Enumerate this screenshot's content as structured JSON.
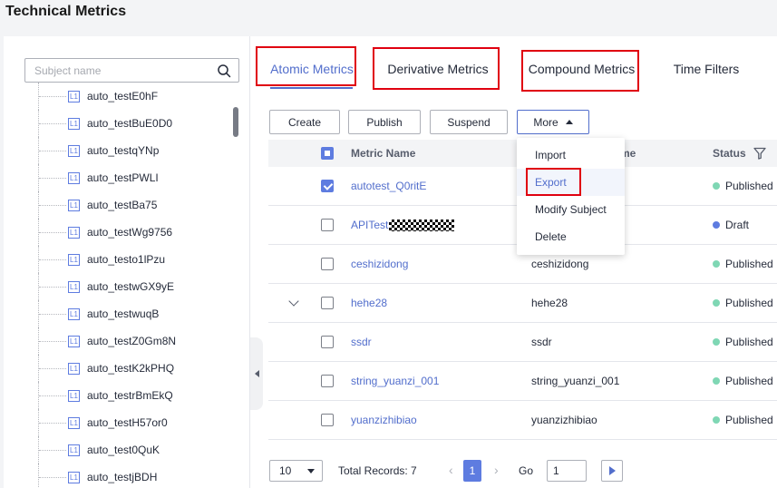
{
  "page": {
    "title": "Technical Metrics"
  },
  "sidebar": {
    "search_placeholder": "Subject name",
    "items": [
      "auto_testE0hF",
      "auto_testBuE0D0",
      "auto_testqYNp",
      "auto_testPWLI",
      "auto_testBa75",
      "auto_testWg9756",
      "auto_testo1lPzu",
      "auto_testwGX9yE",
      "auto_testwuqB",
      "auto_testZ0Gm8N",
      "auto_testK2kPHQ",
      "auto_testrBmEkQ",
      "auto_testH57or0",
      "auto_test0QuK",
      "auto_testjBDH"
    ],
    "leaf_icon_text": "L1"
  },
  "tabs": [
    "Atomic Metrics",
    "Derivative Metrics",
    "Compound Metrics",
    "Time Filters"
  ],
  "toolbar": {
    "create": "Create",
    "publish": "Publish",
    "suspend": "Suspend",
    "more": "More"
  },
  "dropdown": {
    "items": [
      "Import",
      "Export",
      "Modify Subject",
      "Delete"
    ]
  },
  "table": {
    "columns": {
      "metric_name": "Metric Name",
      "hidden_name_fragment": "me",
      "status": "Status"
    },
    "rows": [
      {
        "metric_name": "autotest_Q0ritE",
        "name": "",
        "status": "Published",
        "checked": true
      },
      {
        "metric_name": "APITest",
        "name": "",
        "status": "Draft",
        "checked": false
      },
      {
        "metric_name": "ceshizidong",
        "name": "ceshizidong",
        "status": "Published",
        "checked": false
      },
      {
        "metric_name": "hehe28",
        "name": "hehe28",
        "status": "Published",
        "checked": false
      },
      {
        "metric_name": "ssdr",
        "name": "ssdr",
        "status": "Published",
        "checked": false
      },
      {
        "metric_name": "string_yuanzi_001",
        "name": "string_yuanzi_001",
        "status": "Published",
        "checked": false
      },
      {
        "metric_name": "yuanzizhibiao",
        "name": "yuanzizhibiao",
        "status": "Published",
        "checked": false
      }
    ]
  },
  "status_colors": {
    "Published": "#7fd7b4",
    "Draft": "#5e7ce0"
  },
  "pagination": {
    "page_size": "10",
    "total_records": "Total Records: 7",
    "current_page": "1",
    "go_label": "Go",
    "go_value": "1"
  }
}
